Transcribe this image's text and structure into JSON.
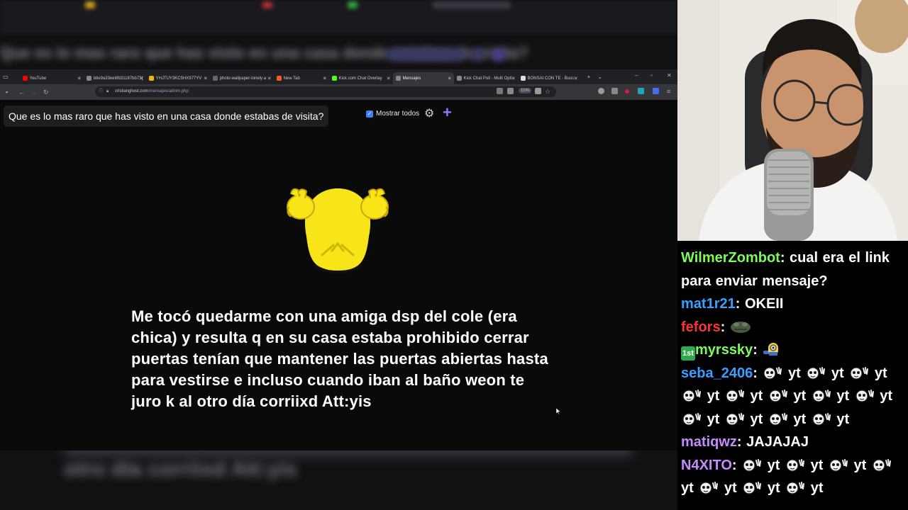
{
  "browser": {
    "tabs": [
      {
        "label": "YouTube",
        "color": "#ff0000",
        "active": false
      },
      {
        "label": "b8e9a33ee6fb31187bb73(",
        "color": "#888888",
        "active": false
      },
      {
        "label": "YHJTUY3KC5HX977YV",
        "color": "#f5b400",
        "active": false
      },
      {
        "label": "photo-wallpaper-lonely-a",
        "color": "#666666",
        "active": false
      },
      {
        "label": "New Tab",
        "color": "#ff5a1f",
        "active": false
      },
      {
        "label": "Kick.com Chat Overlay",
        "color": "#53fc18",
        "active": false
      },
      {
        "label": "Mensajes",
        "color": "#888888",
        "active": true
      },
      {
        "label": "Kick Chat Poll - Multi Opti",
        "color": "#888888",
        "active": false
      },
      {
        "label": "BONSAI CON TE - Busc",
        "color": "#dddddd",
        "active": false
      }
    ],
    "url_domain": "cristianghost.com",
    "url_path": "/mensajes/admin.php",
    "zoom": "110%"
  },
  "page": {
    "question": "Que es lo mas raro que has visto en una casa donde estabas de visita?",
    "show_all_label": "Mostrar todos",
    "show_all_checked": true,
    "message": "Me tocó quedarme con una amiga dsp del cole (era chica) y resulta q en su casa estaba prohibido cerrar puertas tenían que mantener las puertas abiertas hasta para vestirse e incluso cuando iban al baño weon te juro k al otro día corriixd Att:yis"
  },
  "chat": {
    "messages": [
      {
        "user": "WilmerZombot",
        "color": "#7cfc5a",
        "parts": [
          {
            "t": "text",
            "v": "cual era el link para enviar mensaje?"
          }
        ]
      },
      {
        "user": "mat1r21",
        "color": "#3aa0ff",
        "parts": [
          {
            "t": "text",
            "v": "OKEII"
          }
        ]
      },
      {
        "user": "fefors",
        "color": "#ff3333",
        "parts": [
          {
            "t": "emote",
            "v": "frog-emote"
          }
        ]
      },
      {
        "user": "myrssky",
        "color": "#7cfc5a",
        "badge": "1st",
        "parts": [
          {
            "t": "emote",
            "v": "minion-emote"
          }
        ]
      },
      {
        "user": "seba_2406",
        "color": "#3aa0ff",
        "parts": [
          {
            "t": "emote",
            "v": "wave-emote"
          },
          {
            "t": "text",
            "v": "yt"
          },
          {
            "t": "emote",
            "v": "wave-emote"
          },
          {
            "t": "text",
            "v": "yt"
          },
          {
            "t": "emote",
            "v": "wave-emote"
          },
          {
            "t": "text",
            "v": "yt"
          },
          {
            "t": "emote",
            "v": "wave-emote"
          },
          {
            "t": "text",
            "v": "yt"
          },
          {
            "t": "emote",
            "v": "wave-emote"
          },
          {
            "t": "text",
            "v": "yt"
          },
          {
            "t": "emote",
            "v": "wave-emote"
          },
          {
            "t": "text",
            "v": "yt"
          },
          {
            "t": "emote",
            "v": "wave-emote"
          },
          {
            "t": "text",
            "v": "yt"
          },
          {
            "t": "emote",
            "v": "wave-emote"
          },
          {
            "t": "text",
            "v": "yt"
          },
          {
            "t": "emote",
            "v": "wave-emote"
          },
          {
            "t": "text",
            "v": "yt"
          },
          {
            "t": "emote",
            "v": "wave-emote"
          },
          {
            "t": "text",
            "v": "yt"
          },
          {
            "t": "emote",
            "v": "wave-emote"
          },
          {
            "t": "text",
            "v": "yt"
          },
          {
            "t": "emote",
            "v": "wave-emote"
          },
          {
            "t": "text",
            "v": "yt"
          }
        ]
      },
      {
        "user": "matiqwz",
        "color": "#c58cff",
        "parts": [
          {
            "t": "text",
            "v": "JAJAJAJ"
          }
        ]
      },
      {
        "user": "N4XITO",
        "color": "#c58cff",
        "parts": [
          {
            "t": "emote",
            "v": "wave-emote"
          },
          {
            "t": "text",
            "v": "yt"
          },
          {
            "t": "emote",
            "v": "wave-emote"
          },
          {
            "t": "text",
            "v": "yt"
          },
          {
            "t": "emote",
            "v": "wave-emote"
          },
          {
            "t": "text",
            "v": "yt"
          },
          {
            "t": "emote",
            "v": "wave-emote"
          },
          {
            "t": "text",
            "v": "yt"
          },
          {
            "t": "emote",
            "v": "wave-emote"
          },
          {
            "t": "text",
            "v": "yt"
          },
          {
            "t": "emote",
            "v": "wave-emote"
          },
          {
            "t": "text",
            "v": "yt"
          },
          {
            "t": "emote",
            "v": "wave-emote"
          },
          {
            "t": "text",
            "v": "yt"
          }
        ]
      }
    ]
  },
  "background": {
    "blurred_bottom_text": "otro día corriixd Att:yis"
  }
}
